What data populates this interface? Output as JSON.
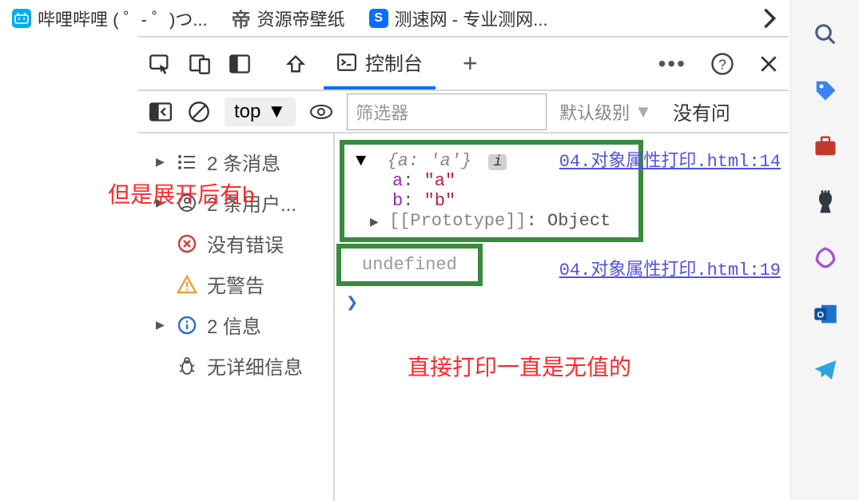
{
  "bookmarks": [
    {
      "label": "哔哩哔哩 (  ゜- ゜)つ..."
    },
    {
      "label": "资源帝壁纸"
    },
    {
      "label": "测速网 - 专业测网..."
    }
  ],
  "devtools": {
    "tabs": {
      "console": "控制台"
    },
    "toolbar": {
      "context": "top",
      "filter_placeholder": "筛选器",
      "level": "默认级别",
      "issues": "没有问"
    }
  },
  "sidebar": {
    "messages": "2 条消息",
    "users": "2 条用户...",
    "errors": "没有错误",
    "warnings": "无警告",
    "info": "2 信息",
    "verbose": "无详细信息"
  },
  "console": {
    "source1": "04.对象属性打印.html:14",
    "source2": "04.对象属性打印.html:19",
    "obj_header": "{a: 'a'}",
    "prop_a_key": "a",
    "prop_a_val": "\"a\"",
    "prop_b_key": "b",
    "prop_b_val": "\"b\"",
    "proto": "[[Prototype]]",
    "proto_val": "Object",
    "undefined": "undefined"
  },
  "annotations": {
    "a1": "但是展开后有b",
    "a2": "直接打印一直是无值的"
  }
}
